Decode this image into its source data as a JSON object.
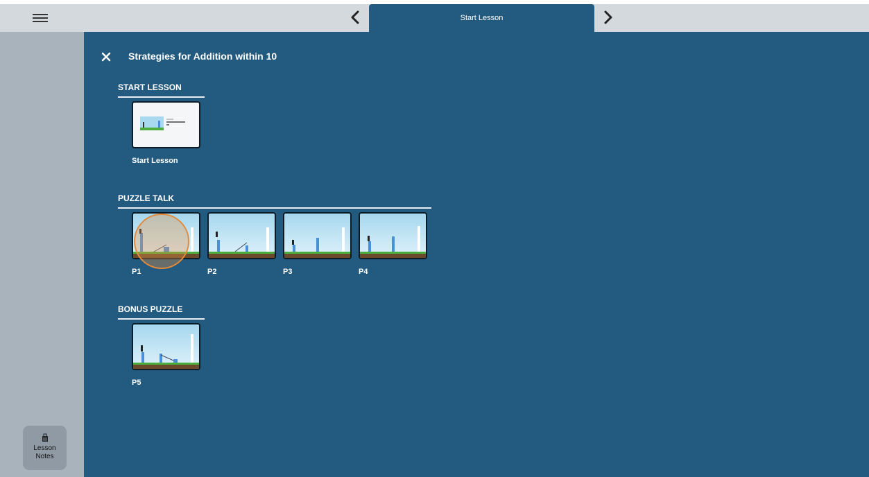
{
  "topbar": {
    "tab_label": "Start Lesson",
    "menu_icon": "hamburger-icon",
    "prev_icon": "chevron-left-icon",
    "next_icon": "chevron-right-icon"
  },
  "sidebar": {
    "lesson_notes_label": "Lesson Notes",
    "lesson_notes_icon": "binder-clip-icon"
  },
  "lesson": {
    "title": "Strategies for Addition within 10",
    "close_icon": "close-icon"
  },
  "sections": [
    {
      "heading": "START LESSON",
      "items": [
        {
          "label": "Start Lesson"
        }
      ]
    },
    {
      "heading": "PUZZLE TALK",
      "items": [
        {
          "label": "P1"
        },
        {
          "label": "P2"
        },
        {
          "label": "P3"
        },
        {
          "label": "P4"
        }
      ]
    },
    {
      "heading": "BONUS PUZZLE",
      "items": [
        {
          "label": "P5"
        }
      ]
    }
  ],
  "colors": {
    "main_bg": "#235a7f",
    "sidebar_bg": "#a9b3bc",
    "topbar_bg": "#d4d9de",
    "cursor_ring": "#e38a3a"
  }
}
